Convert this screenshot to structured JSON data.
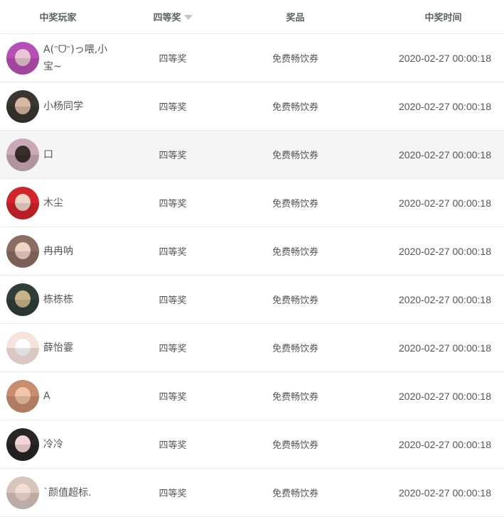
{
  "table": {
    "columns": {
      "player": "中奖玩家",
      "level": "四等奖",
      "prize": "奖品",
      "time": "中奖时间"
    },
    "rows": [
      {
        "name": "A(ᵔᗜᵔ)っ喂,小宝~",
        "level": "四等奖",
        "prize": "免费畅饮券",
        "time": "2020-02-27 00:00:18",
        "avatar_color": "#b84fb6",
        "face_color": "#e9c6d4"
      },
      {
        "name": "小杨同学",
        "level": "四等奖",
        "prize": "免费畅饮券",
        "time": "2020-02-27 00:00:18",
        "avatar_color": "#3b3632",
        "face_color": "#d9b8a2"
      },
      {
        "name": "口",
        "level": "四等奖",
        "prize": "免费畅饮券",
        "time": "2020-02-27 00:00:18",
        "avatar_color": "#c9a9b6",
        "face_color": "#3a2e2c"
      },
      {
        "name": "木尘",
        "level": "四等奖",
        "prize": "免费畅饮券",
        "time": "2020-02-27 00:00:18",
        "avatar_color": "#d2242a",
        "face_color": "#f1d6c8"
      },
      {
        "name": "冉冉呐",
        "level": "四等奖",
        "prize": "免费畅饮券",
        "time": "2020-02-27 00:00:18",
        "avatar_color": "#8c6d63",
        "face_color": "#efd5c6"
      },
      {
        "name": "栋栋栋",
        "level": "四等奖",
        "prize": "免费畅饮券",
        "time": "2020-02-27 00:00:18",
        "avatar_color": "#2f3e38",
        "face_color": "#c9b48a"
      },
      {
        "name": "薛怡霎",
        "level": "四等奖",
        "prize": "免费畅饮券",
        "time": "2020-02-27 00:00:18",
        "avatar_color": "#f6e4dc",
        "face_color": "#ffffff"
      },
      {
        "name": "A",
        "level": "四等奖",
        "prize": "免费畅饮券",
        "time": "2020-02-27 00:00:18",
        "avatar_color": "#c98d6e",
        "face_color": "#f0c5a8"
      },
      {
        "name": "冷冷",
        "level": "四等奖",
        "prize": "免费畅饮券",
        "time": "2020-02-27 00:00:18",
        "avatar_color": "#2a2425",
        "face_color": "#f2d6d6"
      },
      {
        "name": "`颜值超标.",
        "level": "四等奖",
        "prize": "免费畅饮券",
        "time": "2020-02-27 00:00:18",
        "avatar_color": "#d8c4bb",
        "face_color": "#f3ddd3"
      }
    ],
    "highlighted_row": 2
  }
}
